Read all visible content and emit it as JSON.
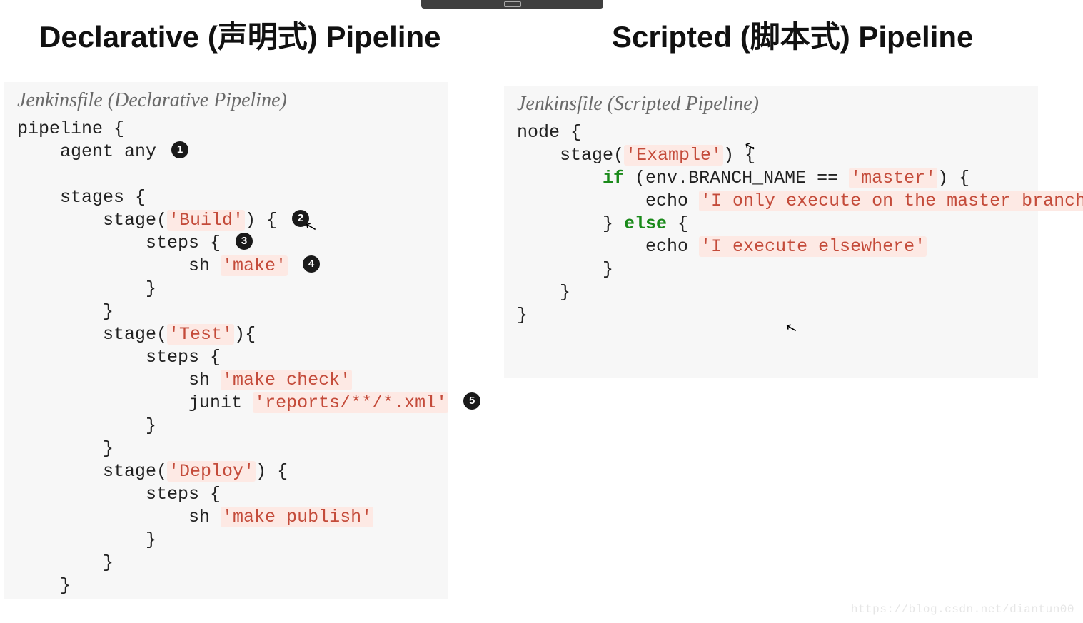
{
  "headings": {
    "left": "Declarative (声明式) Pipeline",
    "right": "Scripted (脚本式)  Pipeline"
  },
  "left_panel": {
    "caption": "Jenkinsfile (Declarative Pipeline)",
    "code": {
      "l1": "pipeline {",
      "l2a": "    agent any ",
      "c1": "1",
      "l3": "    stages {",
      "l4a": "        stage(",
      "l4s": "'Build'",
      "l4b": ") { ",
      "c2": "2",
      "l5a": "            steps { ",
      "c3": "3",
      "l6a": "                sh ",
      "l6s": "'make'",
      "l6b": " ",
      "c4": "4",
      "l7": "            }",
      "l8": "        }",
      "l9a": "        stage(",
      "l9s": "'Test'",
      "l9b": "){",
      "l10": "            steps {",
      "l11a": "                sh ",
      "l11s": "'make check'",
      "l12a": "                junit ",
      "l12s": "'reports/**/*.xml'",
      "l12b": " ",
      "c5": "5",
      "l13": "            }",
      "l14": "        }",
      "l15a": "        stage(",
      "l15s": "'Deploy'",
      "l15b": ") {",
      "l16": "            steps {",
      "l17a": "                sh ",
      "l17s": "'make publish'",
      "l18": "            }",
      "l19": "        }",
      "l20": "    }"
    }
  },
  "right_panel": {
    "caption": "Jenkinsfile (Scripted Pipeline)",
    "code": {
      "l1": "node {",
      "l2a": "    stage(",
      "l2s": "'Example'",
      "l2b": ") {",
      "l3a": "        ",
      "l3k": "if",
      "l3b": " (env.BRANCH_NAME == ",
      "l3s": "'master'",
      "l3c": ") {",
      "l4a": "            echo ",
      "l4s": "'I only execute on the master branch'",
      "l5a": "        } ",
      "l5k": "else",
      "l5b": " {",
      "l6a": "            echo ",
      "l6s": "'I execute elsewhere'",
      "l7": "        }",
      "l8": "    }",
      "l9": "}"
    }
  },
  "watermark": "https://blog.csdn.net/diantun00"
}
